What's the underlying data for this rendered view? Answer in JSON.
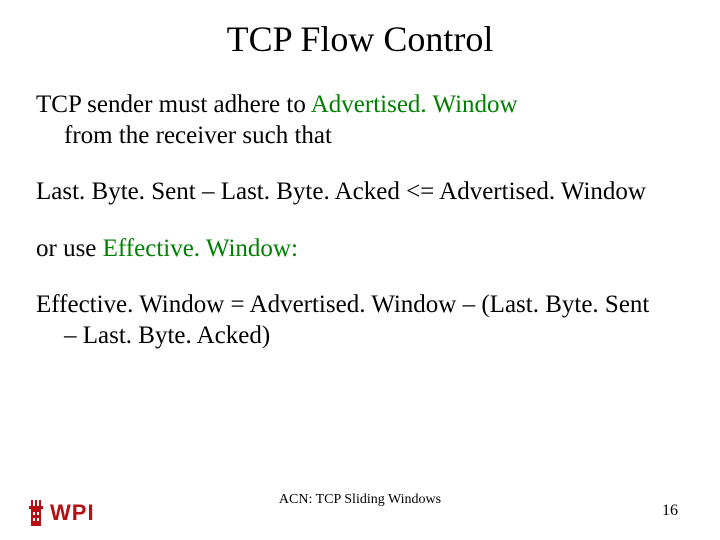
{
  "title": "TCP Flow Control",
  "para1_a": "TCP sender must adhere to ",
  "para1_green": "Advertised. Window",
  "para1_b": " from the receiver such that",
  "para2": "Last. Byte. Sent – Last. Byte. Acked <= Advertised. Window",
  "para3_a": "or use ",
  "para3_green": "Effective. Window:",
  "para4": "Effective. Window = Advertised. Window – (Last. Byte. Sent – Last. Byte. Acked)",
  "footer_center": "ACN: TCP Sliding Windows",
  "page_number": "16",
  "logo_text": "WPI",
  "colors": {
    "green": "#008000",
    "logo_red": "#b70e12"
  }
}
